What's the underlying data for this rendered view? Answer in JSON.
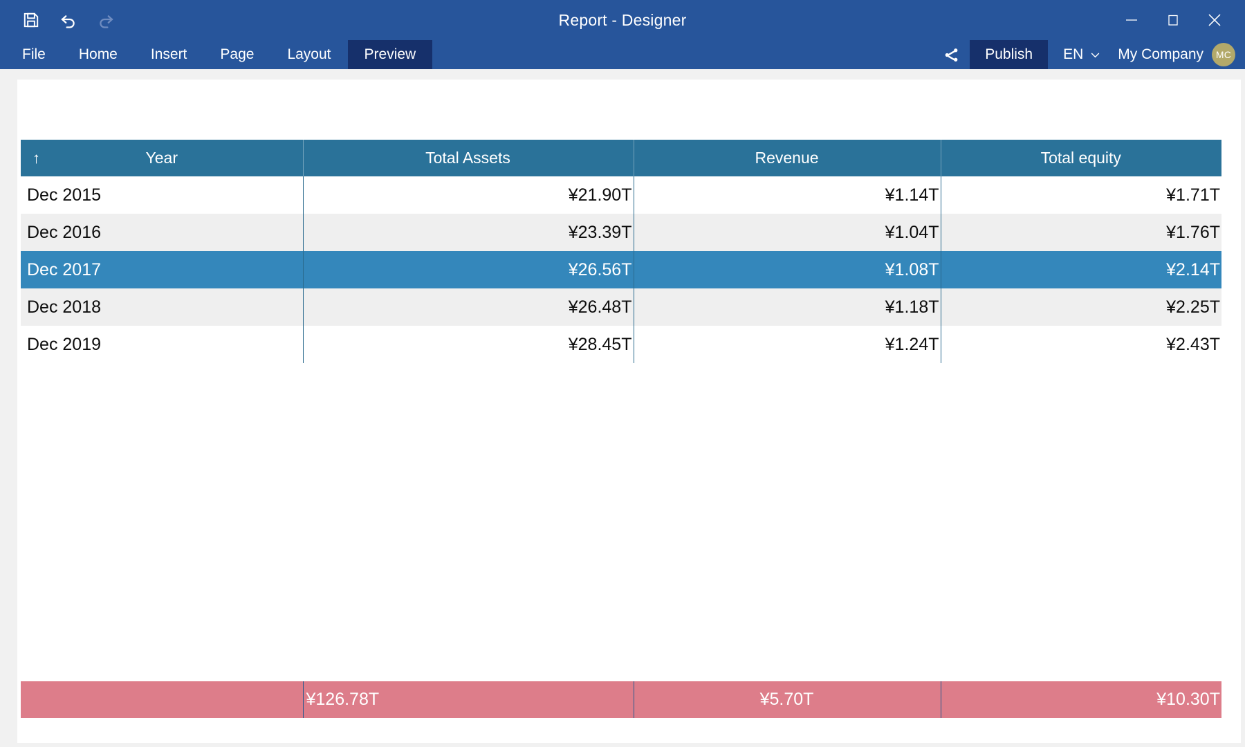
{
  "window": {
    "title": "Report - Designer",
    "minimize_label": "Minimize",
    "maximize_label": "Maximize",
    "close_label": "Close"
  },
  "quick_access": {
    "save_label": "Save",
    "undo_label": "Undo",
    "redo_label": "Redo"
  },
  "menu": {
    "items": [
      {
        "label": "File",
        "active": false
      },
      {
        "label": "Home",
        "active": false
      },
      {
        "label": "Insert",
        "active": false
      },
      {
        "label": "Page",
        "active": false
      },
      {
        "label": "Layout",
        "active": false
      },
      {
        "label": "Preview",
        "active": true
      }
    ],
    "share_label": "Share",
    "publish_label": "Publish",
    "language": "EN",
    "account_name": "My Company",
    "avatar_initials": "MC"
  },
  "table": {
    "sort_indicator": "↑",
    "sort_column": "Year",
    "sort_direction": "ascending",
    "columns": [
      {
        "label": "Year",
        "align": "center"
      },
      {
        "label": "Total Assets",
        "align": "center"
      },
      {
        "label": "Revenue",
        "align": "center"
      },
      {
        "label": "Total equity",
        "align": "center"
      }
    ],
    "rows": [
      {
        "year": "Dec 2015",
        "total_assets": "¥21.90T",
        "revenue": "¥1.14T",
        "total_equity": "¥1.71T",
        "selected": false
      },
      {
        "year": "Dec 2016",
        "total_assets": "¥23.39T",
        "revenue": "¥1.04T",
        "total_equity": "¥1.76T",
        "selected": false
      },
      {
        "year": "Dec 2017",
        "total_assets": "¥26.56T",
        "revenue": "¥1.08T",
        "total_equity": "¥2.14T",
        "selected": true
      },
      {
        "year": "Dec 2018",
        "total_assets": "¥26.48T",
        "revenue": "¥1.18T",
        "total_equity": "¥2.25T",
        "selected": false
      },
      {
        "year": "Dec 2019",
        "total_assets": "¥28.45T",
        "revenue": "¥1.24T",
        "total_equity": "¥2.43T",
        "selected": false
      }
    ],
    "footer": {
      "year": "",
      "total_assets": "¥126.78T",
      "revenue": "¥5.70T",
      "total_equity": "¥10.30T"
    }
  },
  "chart_data": {
    "type": "table",
    "title": "Report - Designer",
    "categories": [
      "Dec 2015",
      "Dec 2016",
      "Dec 2017",
      "Dec 2018",
      "Dec 2019"
    ],
    "xlabel": "Year",
    "ylabel": "",
    "series": [
      {
        "name": "Total Assets",
        "unit": "¥T",
        "values": [
          21.9,
          23.39,
          26.56,
          26.48,
          28.45
        ],
        "total": 126.78
      },
      {
        "name": "Revenue",
        "unit": "¥T",
        "values": [
          1.14,
          1.04,
          1.08,
          1.18,
          1.24
        ],
        "total": 5.7
      },
      {
        "name": "Total equity",
        "unit": "¥T",
        "values": [
          1.71,
          1.76,
          2.14,
          2.25,
          2.43
        ],
        "total": 10.3
      }
    ],
    "selected_category": "Dec 2017",
    "grid": false,
    "legend": "none"
  },
  "colors": {
    "titlebar": "#27559b",
    "menu_active": "#16306b",
    "table_header": "#2a7299",
    "row_selected": "#3487bb",
    "row_alt": "#efefef",
    "footer_total": "#dd7d8a",
    "avatar": "#b3a96a",
    "workspace": "#f1f1f1"
  }
}
